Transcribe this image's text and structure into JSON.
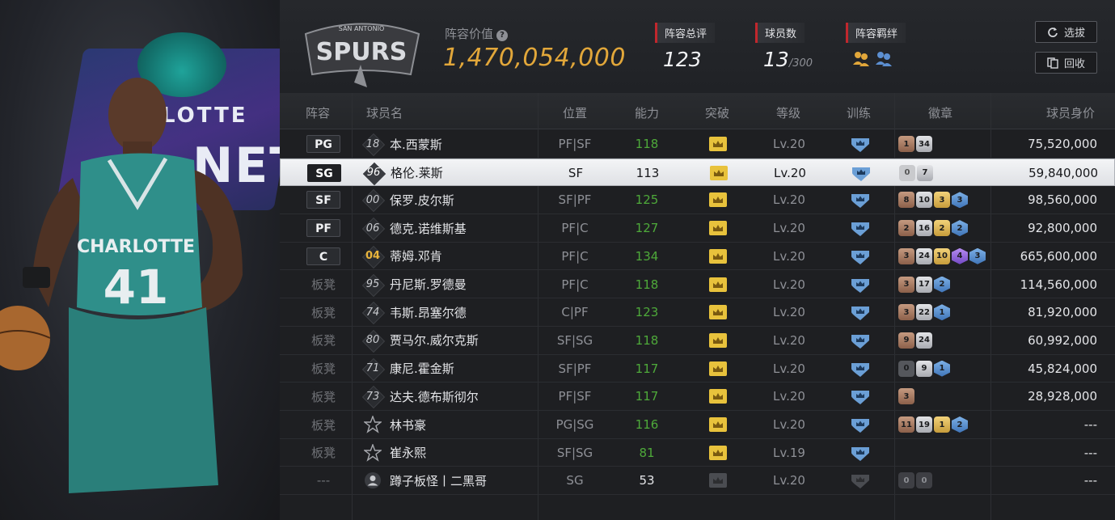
{
  "header": {
    "value_label": "阵容价值",
    "value_amount": "1,470,054,000",
    "team_logo_text": "SPURS",
    "team_logo_subtext": "SAN ANTONIO",
    "stats": [
      {
        "label": "阵容总评",
        "value": "123",
        "sub": ""
      },
      {
        "label": "球员数",
        "value": "13",
        "sub": "/300"
      },
      {
        "label": "阵容羁绊",
        "value": "",
        "sub": ""
      }
    ],
    "buttons": {
      "select": "选拔",
      "recycle": "回收"
    }
  },
  "left_art": {
    "banner_text_top": "LOTTE",
    "banner_text_bottom": "NET",
    "jersey_team": "CHARLOTTE",
    "jersey_number": "41"
  },
  "table": {
    "columns": [
      "阵容",
      "球员名",
      "位置",
      "能力",
      "突破",
      "等级",
      "训练",
      "徽章",
      "球员身价"
    ],
    "rows": [
      {
        "slot": "PG",
        "bench": false,
        "number": "18",
        "name": "本.西蒙斯",
        "position": "PF|SF",
        "ability": "118",
        "level": "Lv.20",
        "badges": [
          {
            "t": "bronze",
            "v": "1"
          },
          {
            "t": "silver",
            "v": "34"
          }
        ],
        "price": "75,520,000"
      },
      {
        "slot": "SG",
        "bench": false,
        "number": "96",
        "name": "格伦.莱斯",
        "position": "SF",
        "ability": "113",
        "level": "Lv.20",
        "badges": [
          {
            "t": "lightgray",
            "v": "0"
          },
          {
            "t": "silver",
            "v": "7"
          }
        ],
        "price": "59,840,000"
      },
      {
        "slot": "SF",
        "bench": false,
        "number": "00",
        "name": "保罗.皮尔斯",
        "position": "SF|PF",
        "ability": "125",
        "level": "Lv.20",
        "badges": [
          {
            "t": "bronze",
            "v": "8"
          },
          {
            "t": "silver",
            "v": "10"
          },
          {
            "t": "gold",
            "v": "3"
          },
          {
            "t": "blue",
            "v": "3"
          }
        ],
        "price": "98,560,000"
      },
      {
        "slot": "PF",
        "bench": false,
        "number": "06",
        "name": "德克.诺维斯基",
        "position": "PF|C",
        "ability": "127",
        "level": "Lv.20",
        "badges": [
          {
            "t": "bronze",
            "v": "2"
          },
          {
            "t": "silver",
            "v": "16"
          },
          {
            "t": "gold",
            "v": "2"
          },
          {
            "t": "blue",
            "v": "2"
          }
        ],
        "price": "92,800,000"
      },
      {
        "slot": "C",
        "bench": false,
        "number": "04",
        "number_gold": true,
        "name": "蒂姆.邓肯",
        "position": "PF|C",
        "ability": "134",
        "level": "Lv.20",
        "badges": [
          {
            "t": "bronze",
            "v": "3"
          },
          {
            "t": "silver",
            "v": "24"
          },
          {
            "t": "gold",
            "v": "10"
          },
          {
            "t": "purple",
            "v": "4"
          },
          {
            "t": "blue",
            "v": "3"
          }
        ],
        "price": "665,600,000"
      },
      {
        "slot": "板凳",
        "bench": true,
        "number": "95",
        "name": "丹尼斯.罗德曼",
        "position": "PF|C",
        "ability": "118",
        "level": "Lv.20",
        "badges": [
          {
            "t": "bronze",
            "v": "3"
          },
          {
            "t": "silver",
            "v": "17"
          },
          {
            "t": "blue",
            "v": "2"
          }
        ],
        "price": "114,560,000"
      },
      {
        "slot": "板凳",
        "bench": true,
        "number": "74",
        "name": "韦斯.昂塞尔德",
        "position": "C|PF",
        "ability": "123",
        "level": "Lv.20",
        "badges": [
          {
            "t": "bronze",
            "v": "3"
          },
          {
            "t": "silver",
            "v": "22"
          },
          {
            "t": "blue",
            "v": "1"
          }
        ],
        "price": "81,920,000"
      },
      {
        "slot": "板凳",
        "bench": true,
        "number": "80",
        "name": "贾马尔.威尔克斯",
        "position": "SF|SG",
        "ability": "118",
        "level": "Lv.20",
        "badges": [
          {
            "t": "bronze",
            "v": "9"
          },
          {
            "t": "silver",
            "v": "24"
          }
        ],
        "price": "60,992,000"
      },
      {
        "slot": "板凳",
        "bench": true,
        "number": "71",
        "name": "康尼.霍金斯",
        "position": "SF|PF",
        "ability": "117",
        "level": "Lv.20",
        "badges": [
          {
            "t": "dark2",
            "v": "0"
          },
          {
            "t": "silver",
            "v": "9"
          },
          {
            "t": "blue",
            "v": "1"
          }
        ],
        "price": "45,824,000"
      },
      {
        "slot": "板凳",
        "bench": true,
        "number": "73",
        "name": "达夫.德布斯彻尔",
        "position": "PF|SF",
        "ability": "117",
        "level": "Lv.20",
        "badges": [
          {
            "t": "bronze",
            "v": "3"
          }
        ],
        "price": "28,928,000"
      },
      {
        "slot": "板凳",
        "bench": true,
        "number": "",
        "star": true,
        "name": "林书豪",
        "position": "PG|SG",
        "ability": "116",
        "level": "Lv.20",
        "badges": [
          {
            "t": "bronze",
            "v": "11"
          },
          {
            "t": "silver",
            "v": "19"
          },
          {
            "t": "gold",
            "v": "1"
          },
          {
            "t": "blue",
            "v": "2"
          }
        ],
        "price": "---"
      },
      {
        "slot": "板凳",
        "bench": true,
        "number": "",
        "star": true,
        "name": "崔永熙",
        "position": "SF|SG",
        "ability": "81",
        "level": "Lv.19",
        "badges": [],
        "price": "---"
      },
      {
        "slot": "---",
        "bench": true,
        "number": "",
        "person": true,
        "name": "蹲子板怪丨二黑哥",
        "position": "SG",
        "ability": "53",
        "ability_white": true,
        "level": "Lv.20",
        "locked": true,
        "badges": [
          {
            "t": "dark",
            "v": "0"
          },
          {
            "t": "dark",
            "v": "0"
          }
        ],
        "price": "---"
      }
    ]
  },
  "colors": {
    "accent_gold": "#e2a73a",
    "ability_green": "#4ea93a",
    "tag_red": "#c1272d"
  }
}
